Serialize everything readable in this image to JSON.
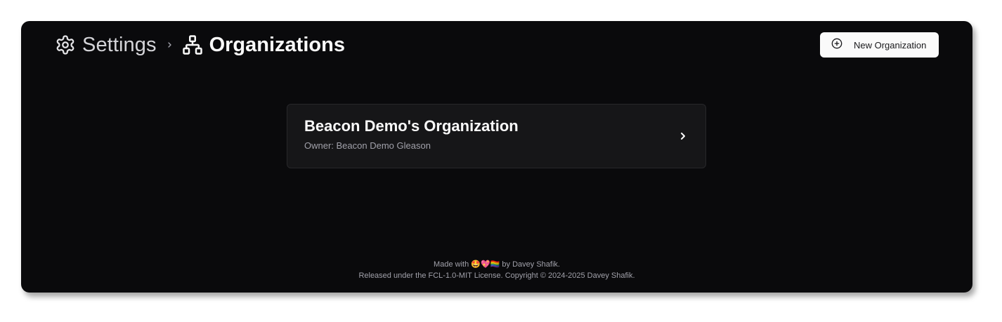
{
  "breadcrumb": {
    "settings_icon": "gear-icon",
    "settings_label": "Settings",
    "separator_icon": "chevron-right-icon",
    "organizations_icon": "network-icon",
    "organizations_label": "Organizations"
  },
  "header": {
    "new_button_icon": "plus-circle-icon",
    "new_button_label": "New Organization"
  },
  "organizations": [
    {
      "name": "Beacon Demo's Organization",
      "owner": "Owner: Beacon Demo Gleason",
      "icon": "chevron-right-icon"
    }
  ],
  "footer": {
    "made_with_prefix": "Made with",
    "made_with_emoji": "🤩💖🏳️‍🌈",
    "made_with_suffix": "by Davey Shafik.",
    "license": "Released under the FCL-1.0-MIT License. Copyright © 2024-2025 Davey Shafik."
  },
  "colors": {
    "background": "#0a0a0c",
    "card": "#161618",
    "button_bg": "#fafafa",
    "muted_text": "#a1a1aa"
  }
}
